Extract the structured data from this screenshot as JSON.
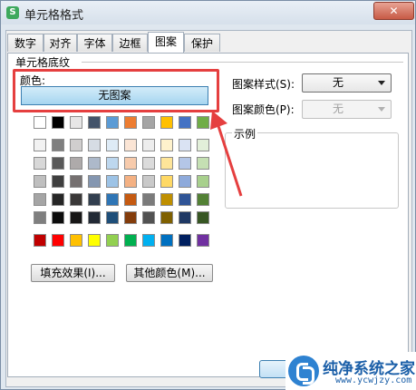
{
  "window": {
    "title": "单元格格式",
    "app_icon": "S",
    "close": "✕"
  },
  "tabs": [
    "数字",
    "对齐",
    "字体",
    "边框",
    "图案",
    "保护"
  ],
  "active_tab": "图案",
  "shading": {
    "group_label": "单元格底纹",
    "color_label": "颜色:",
    "no_pattern_label": "无图案",
    "pattern_style_label": "图案样式(S):",
    "pattern_style_value": "无",
    "pattern_color_label": "图案颜色(P):",
    "pattern_color_value": "无",
    "sample_label": "示例",
    "fill_effects_label": "填充效果(I)...",
    "more_colors_label": "其他颜色(M)..."
  },
  "palette": {
    "theme_top": [
      "#ffffff",
      "#000000",
      "#e7e6e6",
      "#44546a",
      "#5b9bd5",
      "#ed7d31",
      "#a5a5a5",
      "#ffc000",
      "#4472c4",
      "#70ad47"
    ],
    "shades": [
      [
        "#f2f2f2",
        "#7f7f7f",
        "#d0cece",
        "#d6dce4",
        "#deebf6",
        "#fbe5d5",
        "#ededed",
        "#fff2cc",
        "#dae3f3",
        "#e2efd9"
      ],
      [
        "#d8d8d8",
        "#595959",
        "#aeaaaa",
        "#adb9ca",
        "#bdd7ee",
        "#f7cbac",
        "#dbdbdb",
        "#fee599",
        "#b4c6e7",
        "#c5e0b3"
      ],
      [
        "#bfbfbf",
        "#3f3f3f",
        "#757070",
        "#8496b0",
        "#9dc3e6",
        "#f4b183",
        "#c9c9c9",
        "#ffd965",
        "#8eaadb",
        "#a8d08d"
      ],
      [
        "#a5a5a5",
        "#262626",
        "#3a3838",
        "#323f4f",
        "#2e75b5",
        "#c55a11",
        "#7b7b7b",
        "#bf8f00",
        "#2f5496",
        "#538135"
      ],
      [
        "#7f7f7f",
        "#0c0c0c",
        "#171616",
        "#222a35",
        "#1e4e79",
        "#833c0b",
        "#525252",
        "#7f6000",
        "#1f3864",
        "#375623"
      ]
    ],
    "standard": [
      "#c00000",
      "#ff0000",
      "#ffc000",
      "#ffff00",
      "#92d050",
      "#00b050",
      "#00b0f0",
      "#0070c0",
      "#002060",
      "#7030a0"
    ]
  },
  "watermark": {
    "text": "纯净系统之家",
    "url": "www.ycwjzy.com"
  },
  "colors": {
    "annotation_red": "#e53f3f",
    "selected_button": "#a6d5f0"
  }
}
